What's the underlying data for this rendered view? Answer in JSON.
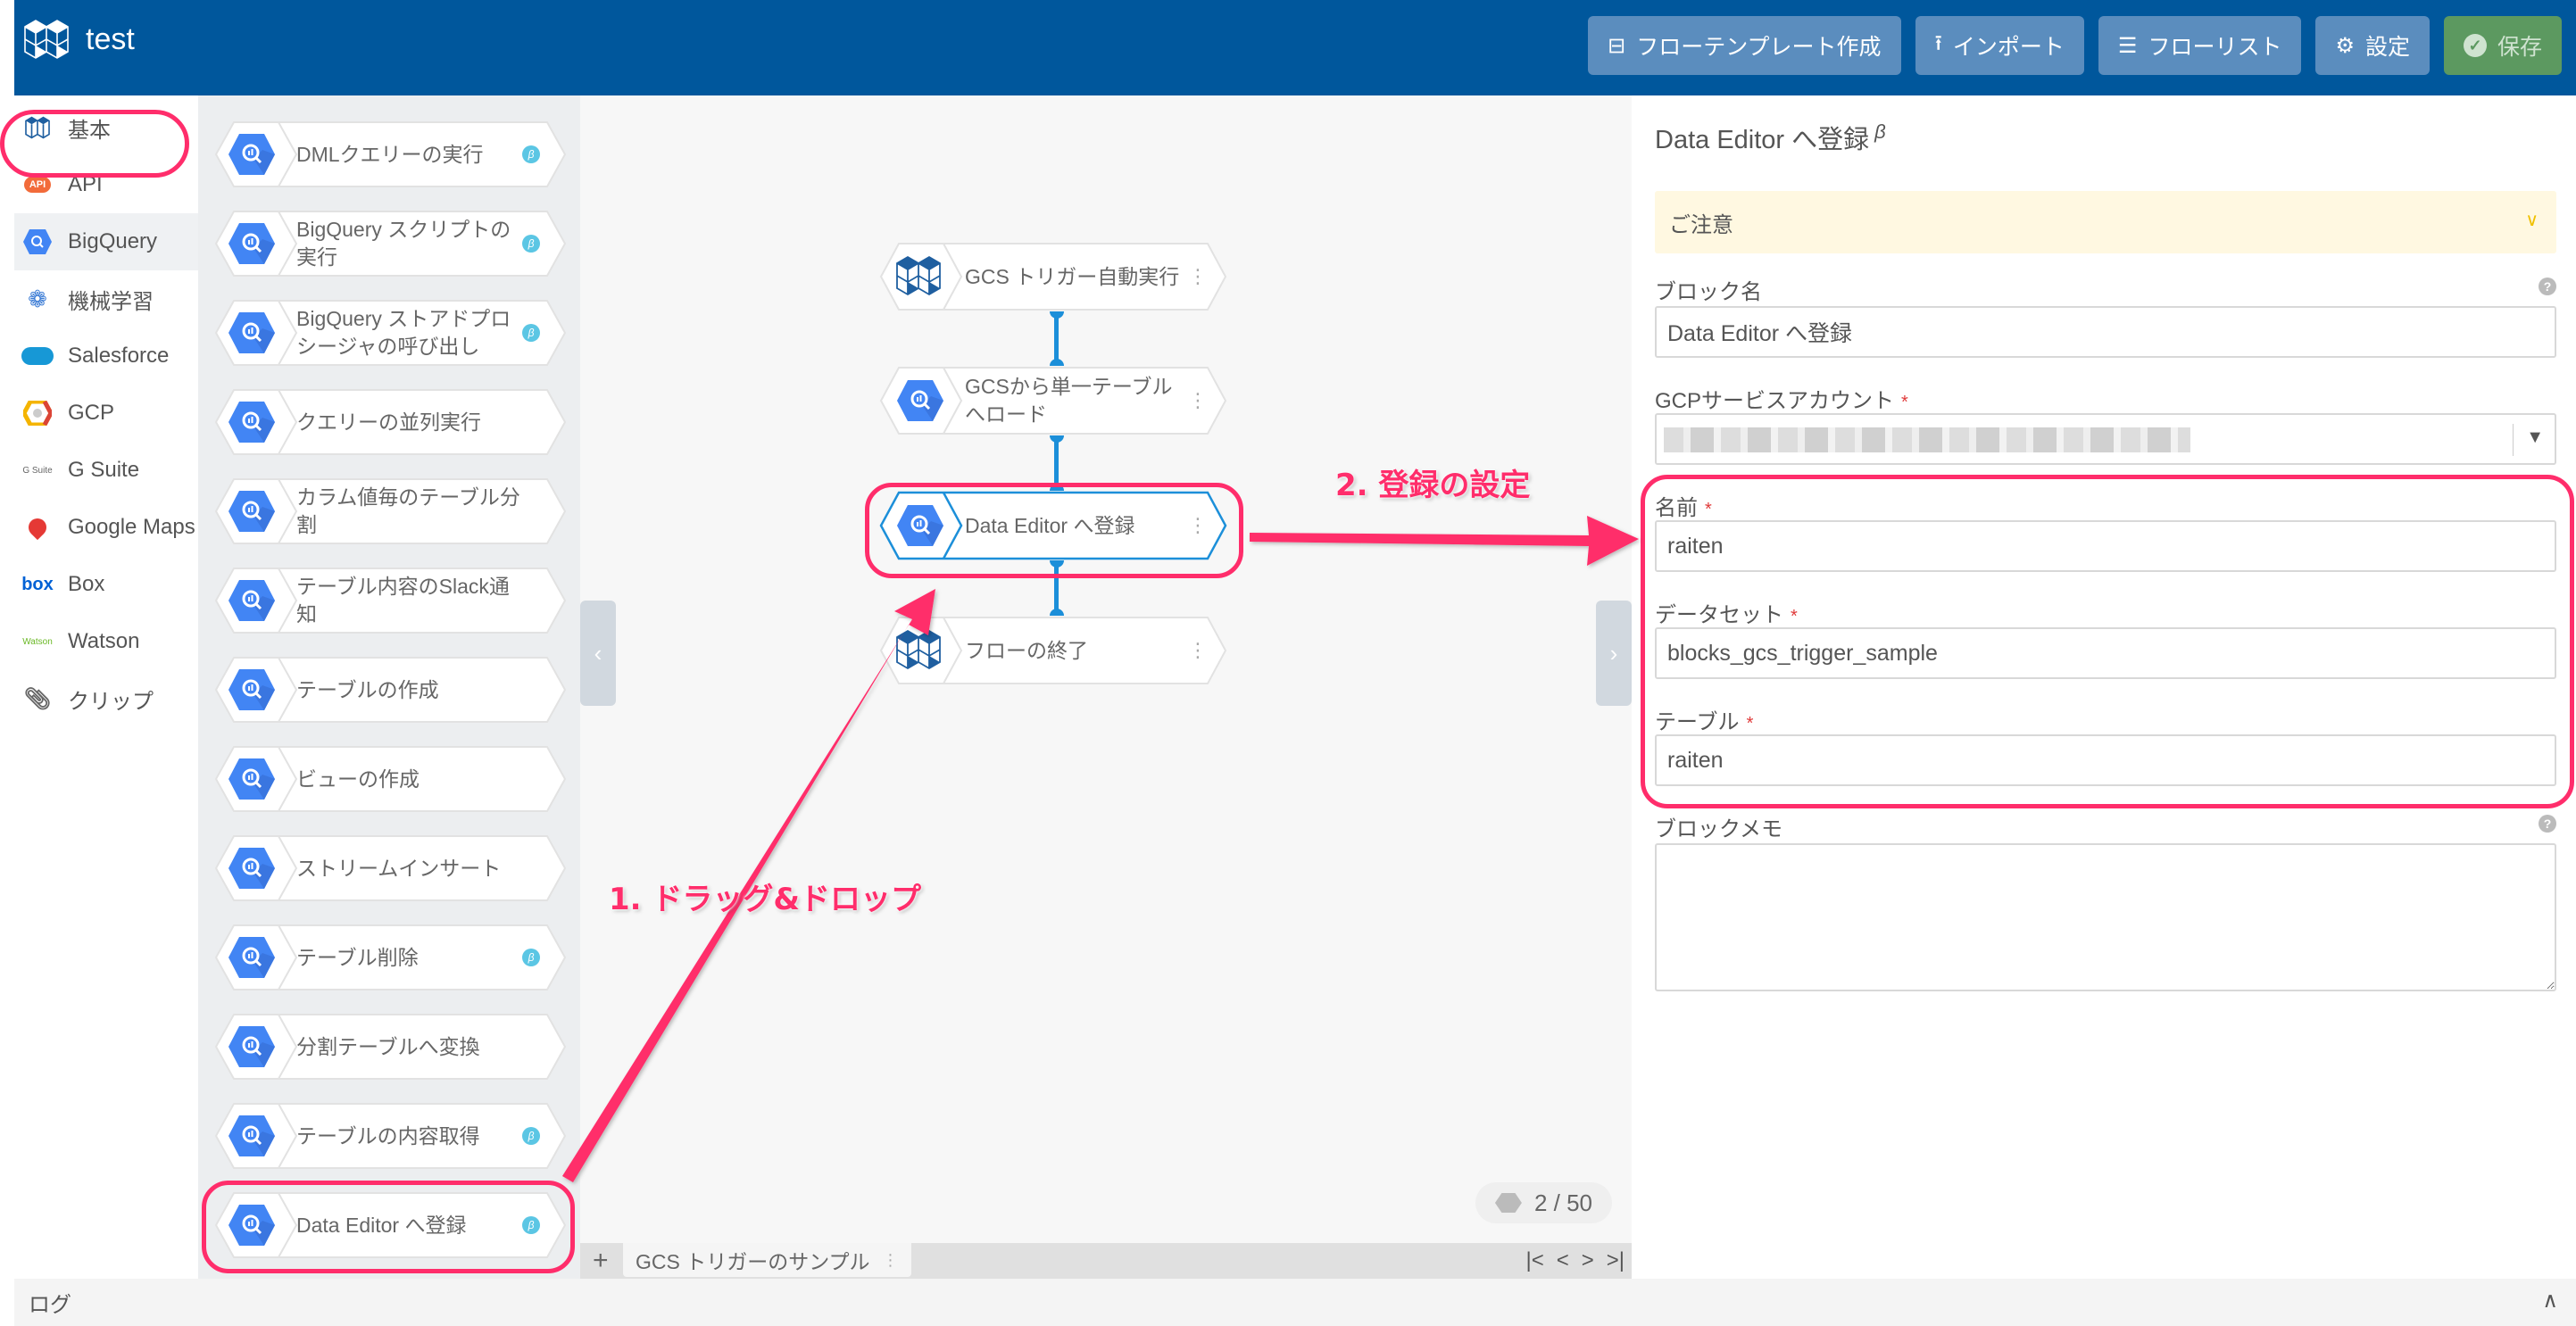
{
  "header": {
    "app_title": "test",
    "buttons": [
      {
        "label": "フローテンプレート作成",
        "icon": "template-icon"
      },
      {
        "label": "インポート",
        "icon": "upload-icon"
      },
      {
        "label": "フローリスト",
        "icon": "list-icon"
      },
      {
        "label": "設定",
        "icon": "gear-icon"
      },
      {
        "label": "保存",
        "icon": "check-circle-icon"
      }
    ],
    "colors": {
      "header_bg": "#00579C",
      "button_bg": "#5B8DBE",
      "save_bg": "#5C9960"
    }
  },
  "categories": [
    {
      "label": "基本",
      "icon": "blocks-logo-icon"
    },
    {
      "label": "API",
      "icon": "api-cloud-icon"
    },
    {
      "label": "BigQuery",
      "icon": "bigquery-icon",
      "active": true
    },
    {
      "label": "機械学習",
      "icon": "brain-icon"
    },
    {
      "label": "Salesforce",
      "icon": "salesforce-cloud-icon"
    },
    {
      "label": "GCP",
      "icon": "gcp-hexagon-icon"
    },
    {
      "label": "G Suite",
      "icon": "gsuite-icon",
      "icon_text": "G Suite"
    },
    {
      "label": "Google Maps",
      "icon": "map-pin-icon"
    },
    {
      "label": "Box",
      "icon": "box-logo-icon",
      "icon_text": "box"
    },
    {
      "label": "Watson",
      "icon": "watson-icon",
      "icon_text": "Watson"
    },
    {
      "label": "クリップ",
      "icon": "paperclip-icon"
    }
  ],
  "palette": {
    "blocks": [
      {
        "label": "DMLクエリーの実行",
        "beta": true
      },
      {
        "label": "BigQuery スクリプトの実行",
        "beta": true
      },
      {
        "label": "BigQuery ストアドプロシージャの呼び出し",
        "beta": true
      },
      {
        "label": "クエリーの並列実行",
        "beta": false
      },
      {
        "label": "カラム値毎のテーブル分割",
        "beta": false
      },
      {
        "label": "テーブル内容のSlack通知",
        "beta": false
      },
      {
        "label": "テーブルの作成",
        "beta": false
      },
      {
        "label": "ビューの作成",
        "beta": false
      },
      {
        "label": "ストリームインサート",
        "beta": false
      },
      {
        "label": "テーブル削除",
        "beta": true
      },
      {
        "label": "分割テーブルへ変換",
        "beta": false
      },
      {
        "label": "テーブルの内容取得",
        "beta": true
      },
      {
        "label": "Data Editor へ登録",
        "beta": true
      }
    ],
    "beta_symbol": "β"
  },
  "canvas": {
    "flow_blocks": [
      {
        "label": "GCS トリガー自動実行",
        "icon": "blocks-logo-icon"
      },
      {
        "label": "GCSから単一テーブルへロード",
        "icon": "bigquery-icon"
      },
      {
        "label": "Data Editor へ登録",
        "icon": "bigquery-icon",
        "selected": true
      },
      {
        "label": "フローの終了",
        "icon": "blocks-logo-icon"
      }
    ],
    "block_counter": "2 / 50",
    "tab": {
      "label": "GCS トリガーのサンプル"
    },
    "add_tab": "+",
    "nav": [
      "|<",
      "<",
      ">",
      ">|"
    ],
    "collapse_left": "‹",
    "collapse_right": "›"
  },
  "annotations": {
    "step1": "1. ドラッグ&ドロップ",
    "step2": "2. 登録の設定",
    "color": "#FF2D6B"
  },
  "panel": {
    "title": "Data Editor へ登録",
    "title_sup": "β",
    "notice": "ご注意",
    "block_name_label": "ブロック名",
    "block_name_value": "Data Editor へ登録",
    "service_account_label": "GCPサービスアカウント",
    "name_label": "名前",
    "name_value": "raiten",
    "dataset_label": "データセット",
    "dataset_value": "blocks_gcs_trigger_sample",
    "table_label": "テーブル",
    "table_value": "raiten",
    "memo_label": "ブロックメモ",
    "memo_value": "",
    "required_mark": "*",
    "help_symbol": "?"
  },
  "log": {
    "label": "ログ",
    "toggle": "∧"
  }
}
